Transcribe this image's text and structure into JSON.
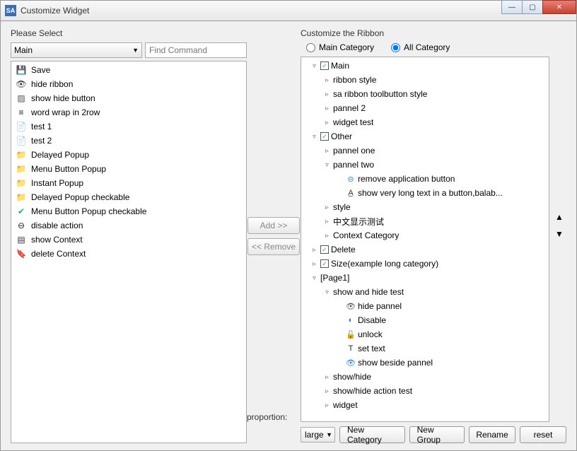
{
  "title": "Customize Widget",
  "titlebar_icon": "SA",
  "left": {
    "label": "Please Select",
    "combo": "Main",
    "search_placeholder": "Find Command",
    "commands": [
      {
        "icon": "💾",
        "cls": "i-save",
        "name": "save-icon",
        "label": "Save"
      },
      {
        "icon": "👁",
        "cls": "i-eye",
        "name": "eye-icon",
        "label": "hide ribbon"
      },
      {
        "icon": "▨",
        "cls": "i-box",
        "name": "box-icon",
        "label": "show hide button"
      },
      {
        "icon": "≡",
        "cls": "i-wrap",
        "name": "wrap-icon",
        "label": "word wrap in 2row"
      },
      {
        "icon": "📄",
        "cls": "i-doc",
        "name": "doc-icon",
        "label": "test 1"
      },
      {
        "icon": "📄",
        "cls": "i-doc",
        "name": "doc-icon",
        "label": "test 2"
      },
      {
        "icon": "📁",
        "cls": "i-folder",
        "name": "folder-icon",
        "label": "Delayed Popup"
      },
      {
        "icon": "📁",
        "cls": "i-folder",
        "name": "folder-icon",
        "label": "Menu Button Popup"
      },
      {
        "icon": "📁",
        "cls": "i-folder",
        "name": "folder-icon",
        "label": "Instant Popup"
      },
      {
        "icon": "📁",
        "cls": "i-folder",
        "name": "folder-check-icon",
        "label": "Delayed Popup checkable"
      },
      {
        "icon": "✔",
        "cls": "i-green",
        "name": "check-icon",
        "label": "Menu Button Popup checkable"
      },
      {
        "icon": "⊖",
        "cls": "i-stop",
        "name": "disable-icon",
        "label": "disable action"
      },
      {
        "icon": "▤",
        "cls": "i-ctx",
        "name": "context-icon",
        "label": "show Context"
      },
      {
        "icon": "🔖",
        "cls": "i-del",
        "name": "bookmark-icon",
        "label": "delete Context"
      }
    ]
  },
  "mid": {
    "add": "Add >>",
    "remove": "<< Remove",
    "proportion_label": "proportion:"
  },
  "right": {
    "label": "Customize the Ribbon",
    "radio_main": "Main Category",
    "radio_all": "All Category",
    "tree": [
      {
        "ind": 0,
        "tw": "▿",
        "chk": true,
        "label": "Main"
      },
      {
        "ind": 1,
        "tw": "▹",
        "label": "ribbon style"
      },
      {
        "ind": 1,
        "tw": "▹",
        "label": "sa ribbon toolbutton style"
      },
      {
        "ind": 1,
        "tw": "▹",
        "label": "pannel 2"
      },
      {
        "ind": 1,
        "tw": "▹",
        "label": "widget test"
      },
      {
        "ind": 0,
        "tw": "▿",
        "chk": true,
        "label": "Other"
      },
      {
        "ind": 1,
        "tw": "▹",
        "label": "pannel one"
      },
      {
        "ind": 1,
        "tw": "▿",
        "label": "pannel two"
      },
      {
        "ind": 2,
        "icon": "⊝",
        "icls": "i-rm",
        "iname": "remove-icon",
        "label": "remove application button"
      },
      {
        "ind": 2,
        "icon": "A̲",
        "icls": "i-tx",
        "iname": "text-icon",
        "label": "show very long text in a button,balab..."
      },
      {
        "ind": 1,
        "tw": "▹",
        "label": "style"
      },
      {
        "ind": 1,
        "tw": "▹",
        "label": "中文显示测试"
      },
      {
        "ind": 1,
        "tw": "▹",
        "label": "Context Category"
      },
      {
        "ind": 0,
        "tw": "▹",
        "chk": true,
        "label": "Delete"
      },
      {
        "ind": 0,
        "tw": "▹",
        "chk": true,
        "label": "Size(example long category)"
      },
      {
        "ind": 0,
        "tw": "▿",
        "label": "[Page1]"
      },
      {
        "ind": 1,
        "tw": "▿",
        "label": "show and hide test"
      },
      {
        "ind": 2,
        "icon": "👁",
        "icls": "i-hide",
        "iname": "eye-hide-icon",
        "label": "hide pannel"
      },
      {
        "ind": 2,
        "icon": "◐",
        "icls": "i-dis",
        "iname": "disable-icon",
        "label": "Disable"
      },
      {
        "ind": 2,
        "icon": "🔓",
        "icls": "i-unlock",
        "iname": "unlock-icon",
        "label": "unlock"
      },
      {
        "ind": 2,
        "icon": "T",
        "icls": "i-txt",
        "iname": "text-t-icon",
        "label": "set text"
      },
      {
        "ind": 2,
        "icon": "👁",
        "icls": "i-showb",
        "iname": "eye-show-icon",
        "label": "show beside pannel"
      },
      {
        "ind": 1,
        "tw": "▹",
        "label": "show/hide"
      },
      {
        "ind": 1,
        "tw": "▹",
        "label": "show/hide action test"
      },
      {
        "ind": 1,
        "tw": "▹",
        "label": "widget"
      }
    ]
  },
  "bottom": {
    "proportion_value": "large",
    "new_category": "New Category",
    "new_group": "New Group",
    "rename": "Rename",
    "reset": "reset"
  }
}
